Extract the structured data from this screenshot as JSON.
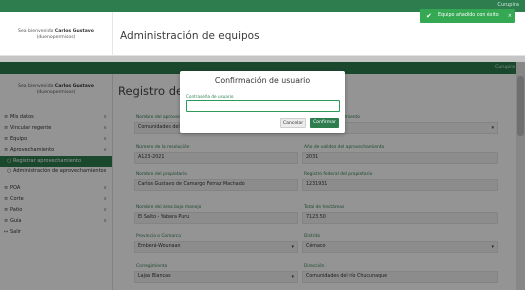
{
  "back_window": {
    "topbar_corner": "Curupira",
    "user_line1": "Sea bienvenido",
    "user_name": "Carlos Gustavo",
    "user_handle": "(duenopermisos)",
    "title": "Administración de equipos",
    "toast": "Equipo añadido con éxito",
    "toast_close": "×"
  },
  "topbar_corner": "Curupira",
  "user": {
    "line1": "Sea bienvenido",
    "name": "Carlos Gustavo",
    "handle": "(duenopermisos)"
  },
  "sidebar": {
    "items": [
      {
        "label": "Mis datos",
        "icon": "menu-icon",
        "chev": "∨"
      },
      {
        "label": "Vincular regente",
        "icon": "menu-icon",
        "chev": "∨"
      },
      {
        "label": "Equipo",
        "icon": "menu-icon",
        "chev": "∨"
      },
      {
        "label": "Aprovechamiento",
        "icon": "menu-icon",
        "chev": "∧"
      },
      {
        "label": "Registrar aprovechamiento",
        "icon": "circle-icon",
        "active": true
      },
      {
        "label": "Administración de aprovechamientos",
        "icon": "circle-icon"
      },
      {
        "label": "POA",
        "icon": "menu-icon",
        "chev": "∨"
      },
      {
        "label": "Corte",
        "icon": "menu-icon",
        "chev": "∨"
      },
      {
        "label": "Patio",
        "icon": "menu-icon",
        "chev": "∨"
      },
      {
        "label": "Guía",
        "icon": "menu-icon",
        "chev": "∨"
      },
      {
        "label": "Salir",
        "icon": "logout-icon"
      }
    ]
  },
  "page_title": "Registro de a",
  "form": {
    "f1_label": "Nombre del aprovechamiento",
    "f1_value": "Comunidades del",
    "f2_label": "Tipo de aprovechamiento",
    "f2_value": "",
    "f3_label": "Número de la resolución",
    "f3_value": "A123-2021",
    "f4_label": "Año de validez del aprovechamiento",
    "f4_value": "2031",
    "f5_label": "Nombre del propietario",
    "f5_value": "Carlos Gustavo de Camargo Ferraz Machado",
    "f6_label": "Registro federal del propietario",
    "f6_value": "1231931",
    "f7_label": "Nombre del área bajo manejo",
    "f7_value": "El Salto - Yabara Puru",
    "f8_label": "Total de hectáreas",
    "f8_value": "7123.50",
    "f9_label": "Provincia o Comarca",
    "f9_value": "Emberá-Wounaan",
    "f10_label": "Distrito",
    "f10_value": "Cémaco",
    "f11_label": "Corregimiento",
    "f11_value": "Lajas Blancas",
    "f12_label": "Dirección",
    "f12_value": "Comunidades del río Chucunaque"
  },
  "modal": {
    "title": "Confirmación de usuario",
    "label": "Contraseña de usuario",
    "value": "",
    "cancel": "Cancelar",
    "confirm": "Confirmar"
  },
  "colors": {
    "brand_green": "#2e7d4f",
    "success_toast": "#34a853"
  }
}
